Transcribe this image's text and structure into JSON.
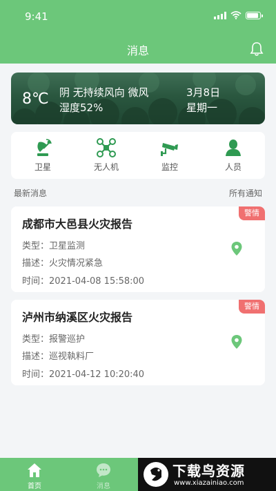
{
  "status_bar": {
    "time": "9:41"
  },
  "nav": {
    "title": "消息",
    "right_icon": "bell-icon"
  },
  "weather": {
    "temperature": "8℃",
    "condition_line": "阴 无持续风向  微风",
    "humidity": "湿度52%",
    "date": "3月8日",
    "weekday": "星期一"
  },
  "categories": [
    {
      "label": "卫星",
      "icon": "satellite-icon"
    },
    {
      "label": "无人机",
      "icon": "drone-icon"
    },
    {
      "label": "监控",
      "icon": "camera-icon"
    },
    {
      "label": "人员",
      "icon": "person-icon"
    }
  ],
  "section": {
    "left_label": "最新消息",
    "right_link": "所有通知"
  },
  "messages": [
    {
      "title": "成都市大邑县火灾报告",
      "badge": "警情",
      "type": "类型：卫星监测",
      "desc": "描述：火灾情况紧急",
      "time": "时间：2021-04-08 15:58:00"
    },
    {
      "title": "泸州市纳溪区火灾报告",
      "badge": "警情",
      "type": "类型：报警巡护",
      "desc": "描述：巡视執料厂",
      "time": "时间：2021-04-12 10:20:40"
    }
  ],
  "tabbar": [
    {
      "label": "首页",
      "icon": "home-icon"
    },
    {
      "label": "消息",
      "icon": "chat-icon"
    }
  ],
  "watermark": {
    "title": "下载鸟资源",
    "url": "www.xiazainiao.com"
  },
  "colors": {
    "brand": "#6cc77a",
    "badge": "#f07070",
    "icon": "#2f9a52"
  }
}
